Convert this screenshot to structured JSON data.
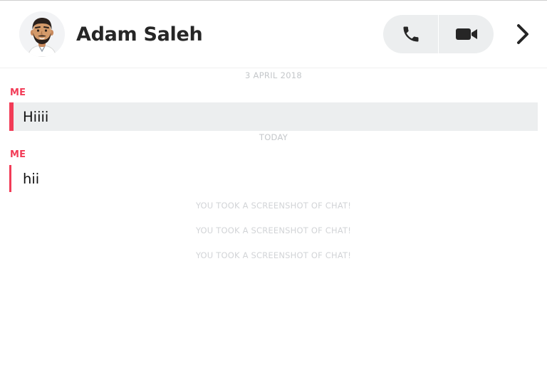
{
  "header": {
    "contact_name": "Adam Saleh",
    "avatar": "bitmoji-avatar",
    "call_buttons": [
      {
        "icon": "phone-icon",
        "action": "voice-call"
      },
      {
        "icon": "video-camera-icon",
        "action": "video-call"
      }
    ],
    "next_icon": "chevron-right-icon"
  },
  "chat": {
    "date_separator_1": "3 APRIL 2018",
    "message_1": {
      "sender": "ME",
      "text": "Hiiii"
    },
    "date_separator_2": "TODAY",
    "message_2": {
      "sender": "ME",
      "text": "hii"
    },
    "notices": [
      "YOU TOOK A SCREENSHOT OF CHAT!",
      "YOU TOOK A SCREENSHOT OF CHAT!",
      "YOU TOOK A SCREENSHOT OF CHAT!"
    ]
  },
  "colors": {
    "accent": "#f23c57",
    "call_group_bg": "#eceeef",
    "highlight_bg": "#eceeef",
    "name_text": "#262626",
    "muted_text": "#c4c7ca"
  }
}
